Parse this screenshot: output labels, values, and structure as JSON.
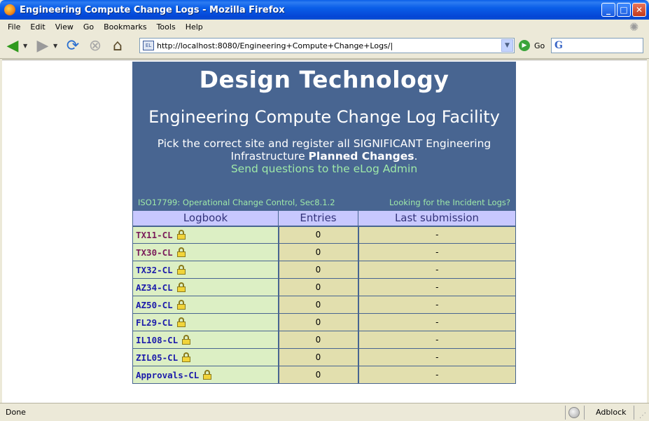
{
  "window": {
    "title": "Engineering Compute Change Logs - Mozilla Firefox"
  },
  "menu": [
    "File",
    "Edit",
    "View",
    "Go",
    "Bookmarks",
    "Tools",
    "Help"
  ],
  "nav": {
    "url": "http://localhost:8080/Engineering+Compute+Change+Logs/|",
    "go_label": "Go",
    "search_engine_icon": "G"
  },
  "banner": {
    "title": "Design Technology",
    "subtitle": "Engineering Compute Change Log Facility",
    "instruction_prefix": "Pick the correct site and register all SIGNIFICANT Engineering Infrastructure ",
    "instruction_bold": "Planned Changes",
    "instruction_suffix": ".",
    "admin_link": "Send questions to the eLog Admin",
    "iso_link": "ISO17799: Operational Change Control, Sec8.1.2",
    "incident_link": "Looking for the Incident Logs?"
  },
  "table": {
    "headers": [
      "Logbook",
      "Entries",
      "Last submission"
    ],
    "rows": [
      {
        "name": "TX11-CL",
        "entries": "0",
        "last": "-",
        "color": "#7a1c5a"
      },
      {
        "name": "TX30-CL",
        "entries": "0",
        "last": "-",
        "color": "#7a1c5a"
      },
      {
        "name": "TX32-CL",
        "entries": "0",
        "last": "-",
        "color": "#1c1cab"
      },
      {
        "name": "AZ34-CL",
        "entries": "0",
        "last": "-",
        "color": "#1c1cab"
      },
      {
        "name": "AZ50-CL",
        "entries": "0",
        "last": "-",
        "color": "#1c1cab"
      },
      {
        "name": "FL29-CL",
        "entries": "0",
        "last": "-",
        "color": "#1c1cab"
      },
      {
        "name": "IL108-CL",
        "entries": "0",
        "last": "-",
        "color": "#1c1cab"
      },
      {
        "name": "ZIL05-CL",
        "entries": "0",
        "last": "-",
        "color": "#1c1cab"
      },
      {
        "name": "Approvals-CL",
        "entries": "0",
        "last": "-",
        "color": "#1c1cab"
      }
    ]
  },
  "status": {
    "text": "Done",
    "adblock": "Adblock"
  },
  "colors": {
    "banner_bg": "#486591",
    "link_green": "#9ee8a8",
    "header_bg": "#c8c8ff",
    "name_bg": "#dcefc4",
    "cell_bg": "#e2dfae"
  }
}
